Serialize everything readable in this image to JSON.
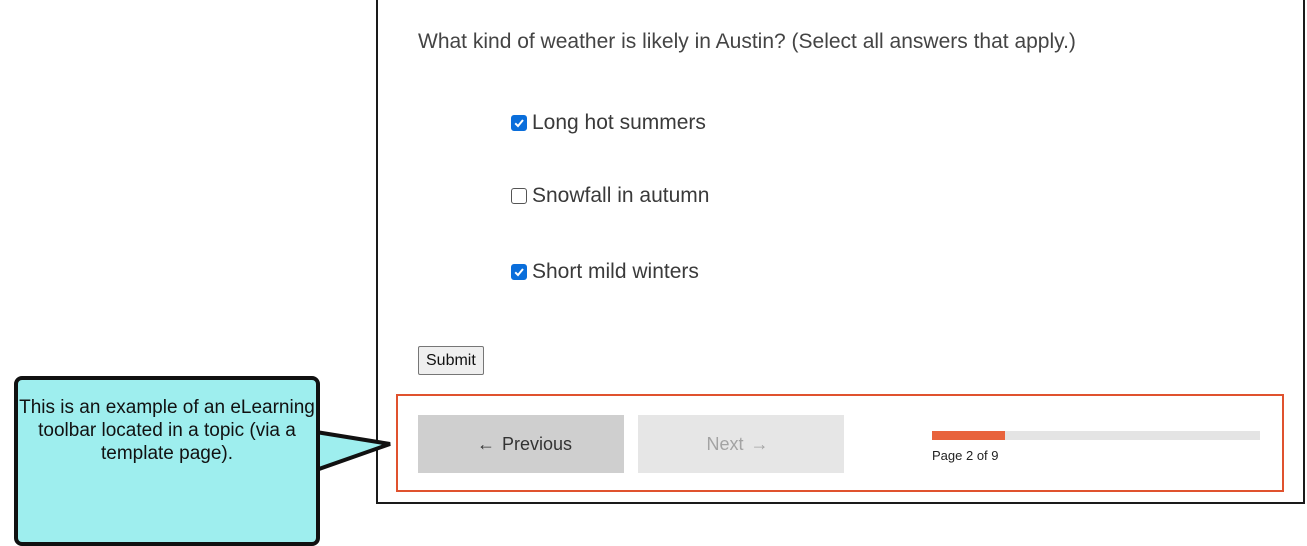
{
  "quiz": {
    "question": "What kind of weather is likely in Austin? (Select all answers that apply.)",
    "options": [
      {
        "label": "Long hot summers",
        "checked": true
      },
      {
        "label": "Snowfall in autumn",
        "checked": false
      },
      {
        "label": "Short mild winters",
        "checked": true
      }
    ],
    "submit_label": "Submit"
  },
  "toolbar": {
    "previous_label": "Previous",
    "previous_arrow": "←",
    "next_label": "Next",
    "next_arrow": "→",
    "progress": {
      "current": 2,
      "total": 9,
      "label": "Page 2 of 9"
    }
  },
  "callout": {
    "text": "This is an example of an eLearning toolbar located in a topic (via a template page)."
  },
  "colors": {
    "toolbar_border": "#e0522e",
    "progress_fill": "#e8633c",
    "callout_background": "#9eeeee",
    "checkbox_checked": "#0a6edb"
  }
}
